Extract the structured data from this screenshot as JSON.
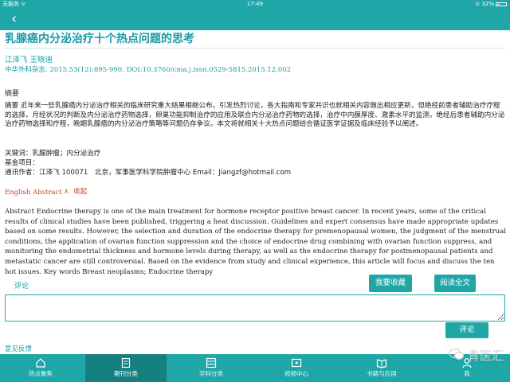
{
  "status_bar": {
    "carrier": "无服务 ᯤ",
    "time": "17:49",
    "battery": "⊙ 32%"
  },
  "article": {
    "title": "乳腺癌内分泌治疗十个热点问题的思考",
    "authors": "江泽飞 王晓迪",
    "citation": "中华外科杂志. 2015,53(12):895-990. DOI:10.3760/cma.j.issn.0529-5815.2015.12.002",
    "abstract_heading": "摘要",
    "abstract_text": "摘要 近年来一些乳腺癌内分泌治疗相关的临床研究重大结果相继公布，引发热烈讨论，各大指南和专家共识也就相关内容做出相应更新，但绝经前患者辅助治疗疗程的选择，月经状况的判断及内分泌治疗药物选择，卵巢功能抑制治疗的应用及联合内分泌治疗药物的选择，治疗中内膜厚度、激素水平的监测，绝经后患者辅助内分泌治疗药物选择和疗程，晚期乳腺癌的内分泌治疗策略等问题仍存争议。本文将就相关十大热点问题结合循证医学证据及临床经验予以阐述。",
    "keywords": "关键词：乳腺肿瘤；内分泌治疗",
    "fund": "基金项目：",
    "contact": "通讯作者：江泽飞 100071　北京，军事医学科学院肿瘤中心 Email：Jiangzf@hotmail.com",
    "english_label": "English Abstract",
    "collapse_label": "收起",
    "english_abstract": "Abstract Endocrine therapy is one of the main treatment for hormone receptor positive breast cancer. In recent years, some of the critical results of clinical studies have been published, triggering a heat discussion. Guidelines and expert consensus have made appropriate updates based on some results. However, the selection and duration of the endocrine therapy for premenopausal women, the judgment of the menstrual conditions, the application of ovarian function suppression and the choice of endocrine drug combining with ovarian function suppress, and monitoring the endometrial thickness and hormone levels during therapy, as well as the endocrine therapy for postmenopausal patients and metastatic cancer are still controversial. Based on the evidence from study and clinical experience, this article will focus and discuss the ten hot issues. Key words Breast neoplasms; Endocrine therapy"
  },
  "comment": {
    "label": "评论",
    "collect_button": "我要收藏",
    "fulltext_button": "阅读全文",
    "input_value": "",
    "submit_button": "评论",
    "feedback": "意见反馈"
  },
  "tabs": [
    {
      "label": "热点聚焦",
      "icon": "home-icon",
      "active": false
    },
    {
      "label": "期刊分类",
      "icon": "journal-icon",
      "active": true
    },
    {
      "label": "学科分类",
      "icon": "grid-icon",
      "active": false
    },
    {
      "label": "视频中心",
      "icon": "video-icon",
      "active": false
    },
    {
      "label": "书籍与应用",
      "icon": "book-icon",
      "active": false
    },
    {
      "label": "我",
      "icon": "person-icon",
      "active": false
    }
  ],
  "watermark": {
    "text": "青医汇",
    "icon": "wechat-icon"
  },
  "colors": {
    "accent": "#1fa7a8",
    "accent_dark": "#167f80",
    "title": "#1a9ba6",
    "english_toggle": "#b94a2a"
  }
}
